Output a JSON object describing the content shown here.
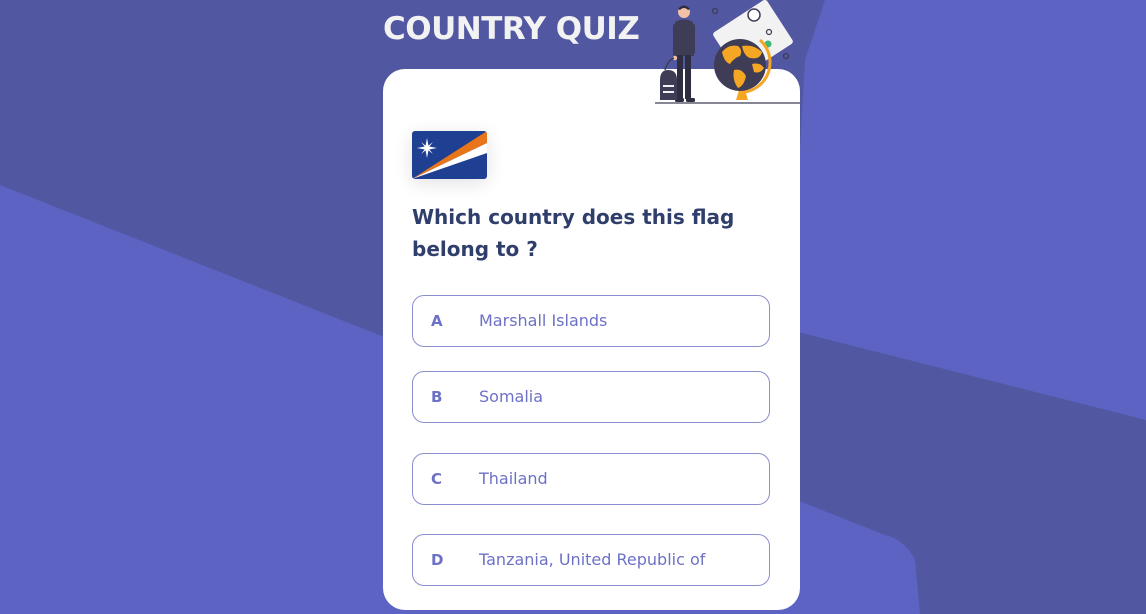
{
  "header": {
    "title": "COUNTRY QUIZ"
  },
  "quiz": {
    "flag_icon": "marshall-islands-flag",
    "question": "Which country does this flag belong to ?",
    "options": [
      {
        "letter": "A",
        "label": "Marshall Islands"
      },
      {
        "letter": "B",
        "label": "Somalia"
      },
      {
        "letter": "C",
        "label": "Thailand"
      },
      {
        "letter": "D",
        "label": "Tanzania, United Republic of"
      }
    ]
  },
  "illustration": {
    "icon": "traveler-with-globe-illustration"
  },
  "colors": {
    "background": "#5d63c2",
    "background_dark": "#5157a1",
    "title": "#f2f2f2",
    "question_text": "#2f3e6b",
    "option_text": "#6d71c6",
    "option_border": "#8b8ed0"
  }
}
